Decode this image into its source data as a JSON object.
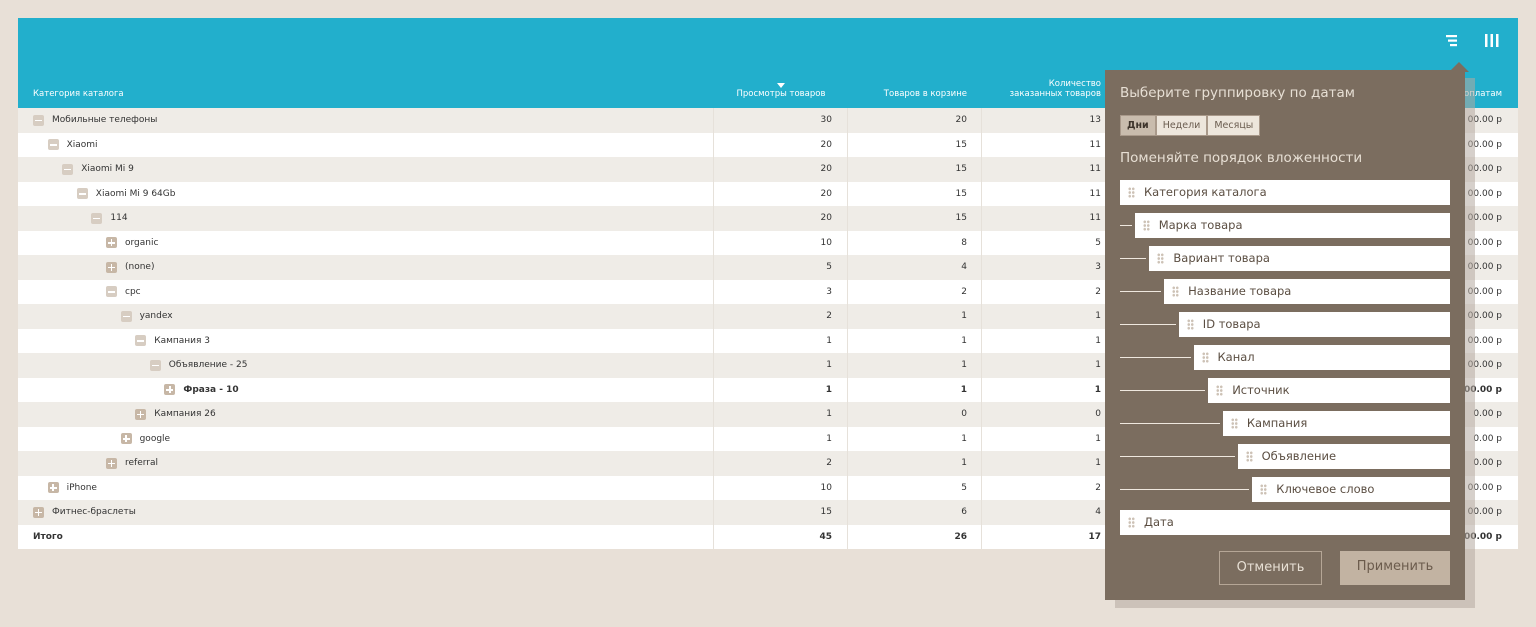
{
  "toolbar": {
    "filter_icon": "filter-icon",
    "columns_icon": "columns-icon"
  },
  "columns": {
    "category": "Категория каталога",
    "views": "Просмотры товаров",
    "cart": "Товаров в корзине",
    "ordered_line1": "Количество",
    "ordered_line2": "заказанных товаров",
    "payments_partial": "оплатам"
  },
  "rows": [
    {
      "label": "Мобильные телефоны",
      "level": 0,
      "toggle": "minus",
      "views": "30",
      "cart": "20",
      "ordered": "13",
      "payments": "00.00 р"
    },
    {
      "label": "Xiaomi",
      "level": 1,
      "toggle": "minus",
      "views": "20",
      "cart": "15",
      "ordered": "11",
      "payments": "00.00 р"
    },
    {
      "label": "Xiaomi Mi 9",
      "level": 2,
      "toggle": "minus",
      "views": "20",
      "cart": "15",
      "ordered": "11",
      "payments": "00.00 р"
    },
    {
      "label": "Xiaomi Mi 9 64Gb",
      "level": 3,
      "toggle": "minus",
      "views": "20",
      "cart": "15",
      "ordered": "11",
      "payments": "00.00 р"
    },
    {
      "label": "114",
      "level": 4,
      "toggle": "minus",
      "views": "20",
      "cart": "15",
      "ordered": "11",
      "payments": "00.00 р"
    },
    {
      "label": "organic",
      "level": 5,
      "toggle": "plus",
      "views": "10",
      "cart": "8",
      "ordered": "5",
      "payments": "00.00 р"
    },
    {
      "label": "(none)",
      "level": 5,
      "toggle": "plus",
      "views": "5",
      "cart": "4",
      "ordered": "3",
      "payments": "00.00 р"
    },
    {
      "label": "cpc",
      "level": 5,
      "toggle": "minus",
      "views": "3",
      "cart": "2",
      "ordered": "2",
      "payments": "00.00 р"
    },
    {
      "label": "yandex",
      "level": 6,
      "toggle": "minus",
      "views": "2",
      "cart": "1",
      "ordered": "1",
      "payments": "00.00 р"
    },
    {
      "label": "Кампания 3",
      "level": 7,
      "toggle": "minus",
      "views": "1",
      "cart": "1",
      "ordered": "1",
      "payments": "00.00 р"
    },
    {
      "label": "Объявление - 25",
      "level": 8,
      "toggle": "minus",
      "views": "1",
      "cart": "1",
      "ordered": "1",
      "payments": "00.00 р"
    },
    {
      "label": "Фраза - 10",
      "level": 9,
      "toggle": "plus",
      "views": "1",
      "cart": "1",
      "ordered": "1",
      "payments": "00.00 р",
      "bold": true
    },
    {
      "label": "Кампания 26",
      "level": 7,
      "toggle": "plus",
      "views": "1",
      "cart": "0",
      "ordered": "0",
      "payments": "0.00 р"
    },
    {
      "label": "google",
      "level": 6,
      "toggle": "plus",
      "views": "1",
      "cart": "1",
      "ordered": "1",
      "payments": "0.00 р"
    },
    {
      "label": "referral",
      "level": 5,
      "toggle": "plus",
      "views": "2",
      "cart": "1",
      "ordered": "1",
      "payments": "0.00 р"
    },
    {
      "label": "iPhone",
      "level": 1,
      "toggle": "plus",
      "views": "10",
      "cart": "5",
      "ordered": "2",
      "payments": "00.00 р"
    },
    {
      "label": "Фитнес-браслеты",
      "level": 0,
      "toggle": "plus",
      "views": "15",
      "cart": "6",
      "ordered": "4",
      "payments": "00.00 р"
    }
  ],
  "total": {
    "label": "Итого",
    "views": "45",
    "cart": "26",
    "ordered": "17",
    "payments": "00.00 р"
  },
  "popup": {
    "group_title": "Выберите группировку по датам",
    "group_options": [
      "Дни",
      "Недели",
      "Месяцы"
    ],
    "group_selected": "Дни",
    "order_title": "Поменяйте порядок вложенности",
    "order_items": [
      "Категория каталога",
      "Марка товара",
      "Вариант товара",
      "Название товара",
      "ID товара",
      "Канал",
      "Источник",
      "Кампания",
      "Объявление",
      "Ключевое слово",
      "Дата"
    ],
    "cancel": "Отменить",
    "apply": "Применить"
  }
}
